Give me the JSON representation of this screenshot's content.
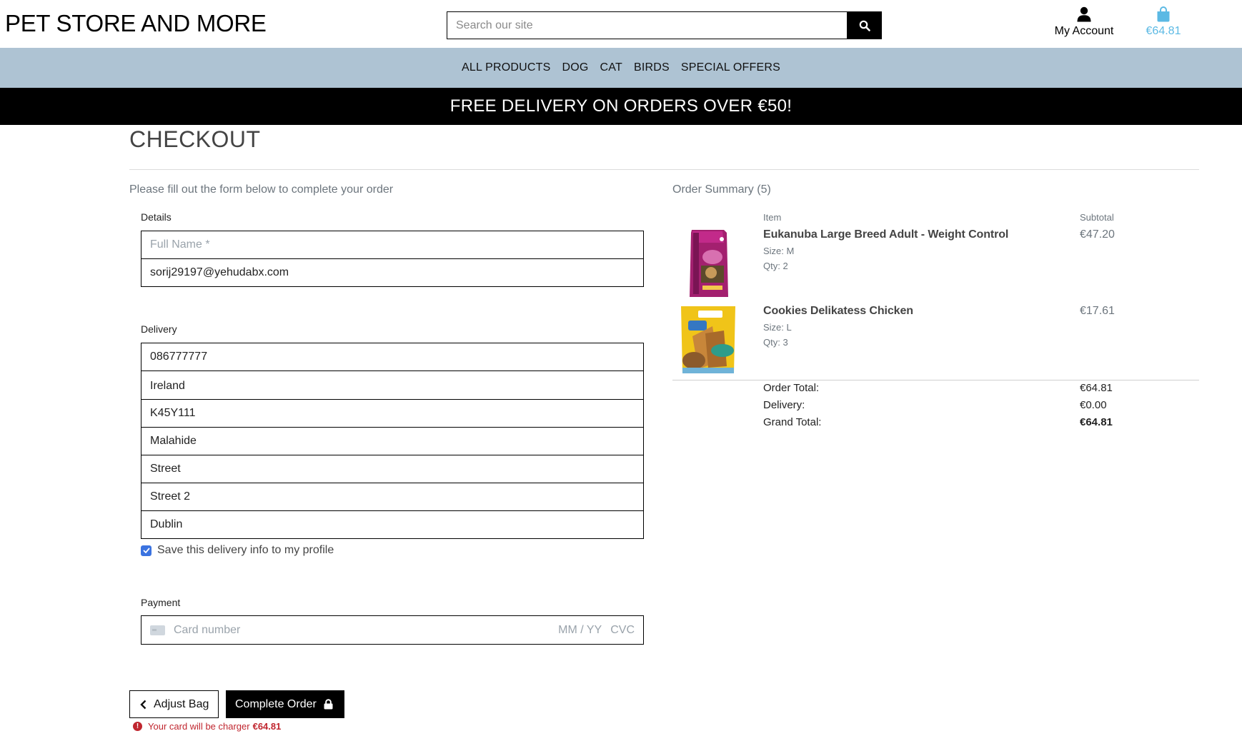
{
  "header": {
    "brand": "PET STORE AND MORE",
    "search_placeholder": "Search our site",
    "account_label": "My Account",
    "bag_total": "€64.81",
    "bag_color": "#5bb9e4"
  },
  "nav": {
    "items": [
      "ALL PRODUCTS",
      "DOG",
      "CAT",
      "BIRDS",
      "SPECIAL OFFERS"
    ],
    "background": "#aec3d3"
  },
  "banner": {
    "text": "FREE DELIVERY ON ORDERS OVER €50!"
  },
  "checkout": {
    "title": "CHECKOUT",
    "intro": "Please fill out the form below to complete your order",
    "details": {
      "legend": "Details",
      "full_name_placeholder": "Full Name *",
      "email_value": "sorij29197@yehudabx.com"
    },
    "delivery": {
      "legend": "Delivery",
      "phone": "086777777",
      "country": "Ireland",
      "postcode": "K45Y111",
      "town": "Malahide",
      "street1": "Street",
      "street2": "Street 2",
      "county": "Dublin",
      "save_label": "Save this delivery info to my profile",
      "save_checked": true
    },
    "payment": {
      "legend": "Payment",
      "card_placeholder": "Card number",
      "expiry_placeholder": "MM / YY",
      "cvc_placeholder": "CVC"
    },
    "buttons": {
      "adjust_bag": "Adjust Bag",
      "complete_order": "Complete Order"
    },
    "charge_prefix": "Your card will be charger ",
    "charge_amount": "€64.81"
  },
  "summary": {
    "title": "Order Summary (5)",
    "col_item": "Item",
    "col_subtotal": "Subtotal",
    "items": [
      {
        "name": "Eukanuba Large Breed Adult - Weight Control",
        "size": "Size: M",
        "qty": "Qty: 2",
        "subtotal": "€47.20",
        "image_icon": "dog-food-bag-image"
      },
      {
        "name": "Cookies Delikatess Chicken",
        "size": "Size: L",
        "qty": "Qty: 3",
        "subtotal": "€17.61",
        "image_icon": "dog-treats-bag-image"
      }
    ],
    "order_total_label": "Order Total:",
    "order_total": "€64.81",
    "delivery_label": "Delivery:",
    "delivery": "€0.00",
    "grand_total_label": "Grand Total:",
    "grand_total": "€64.81"
  }
}
